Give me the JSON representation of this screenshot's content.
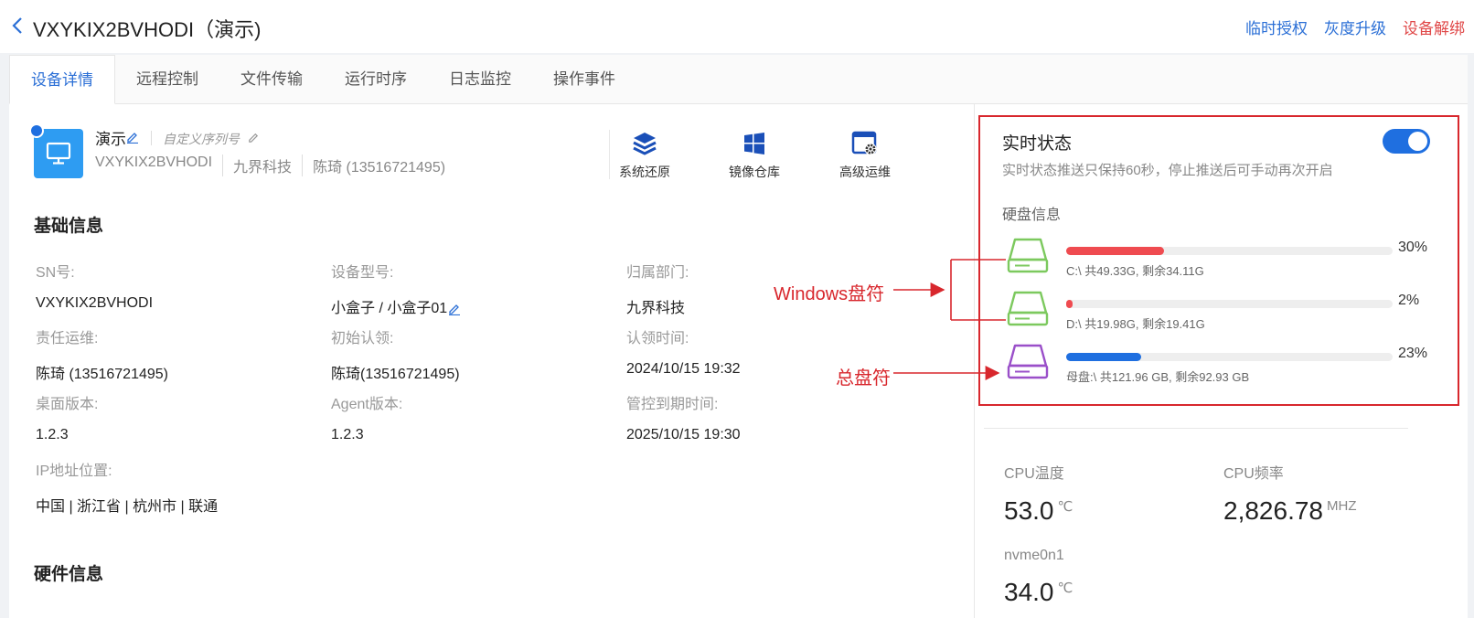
{
  "header": {
    "title": "VXYKIX2BVHODI（演示)",
    "actions": [
      "临时授权",
      "灰度升级",
      "设备解绑"
    ]
  },
  "tabs": [
    "设备详情",
    "远程控制",
    "文件传输",
    "运行时序",
    "日志监控",
    "操作事件"
  ],
  "device": {
    "name": "演示",
    "serial_placeholder": "自定义序列号",
    "meta": [
      "VXYKIX2BVHODI",
      "九界科技",
      "陈琦 (13516721495)"
    ]
  },
  "quick_actions": [
    {
      "label": "系统还原",
      "icon": "layers-icon"
    },
    {
      "label": "镜像仓库",
      "icon": "windows-icon"
    },
    {
      "label": "高级运维",
      "icon": "settings-window-icon"
    }
  ],
  "basic_info": {
    "title": "基础信息",
    "fields": [
      {
        "label": "SN号:",
        "value": "VXYKIX2BVHODI"
      },
      {
        "label": "设备型号:",
        "value": "小盒子  / 小盒子01"
      },
      {
        "label": "归属部门:",
        "value": "九界科技"
      },
      {
        "label": "责任运维:",
        "value": "陈琦 (13516721495)"
      },
      {
        "label": "初始认领:",
        "value": "陈琦(13516721495)"
      },
      {
        "label": "认领时间:",
        "value": "2024/10/15 19:32"
      },
      {
        "label": "桌面版本:",
        "value": "1.2.3"
      },
      {
        "label": "Agent版本:",
        "value": "1.2.3"
      },
      {
        "label": "管控到期时间:",
        "value": "2025/10/15 19:30"
      },
      {
        "label": "IP地址位置:",
        "value": "中国 | 浙江省 | 杭州市 | 联通"
      }
    ]
  },
  "hardware_info": {
    "title": "硬件信息"
  },
  "realtime": {
    "title": "实时状态",
    "desc": "实时状态推送只保持60秒，停止推送后可手动再次开启",
    "toggle_on": true,
    "disk_title": "硬盘信息",
    "disks": [
      {
        "text": "C:\\ 共49.33G, 剩余34.11G",
        "percent_label": "30%",
        "percent": 30,
        "color": "#ef4b50",
        "icon_color": "#7cc95e"
      },
      {
        "text": "D:\\ 共19.98G, 剩余19.41G",
        "percent_label": "2%",
        "percent": 2,
        "color": "#ef4b50",
        "icon_color": "#7cc95e"
      },
      {
        "text": "母盘:\\ 共121.96 GB, 剩余92.93 GB",
        "percent_label": "23%",
        "percent": 23,
        "color": "#1f6fe0",
        "icon_color": "#9a4fc9"
      }
    ]
  },
  "metrics": [
    {
      "label": "CPU温度",
      "value": "53.0",
      "unit": "℃"
    },
    {
      "label": "CPU频率",
      "value": "2,826.78",
      "unit": "MHZ"
    },
    {
      "label": "nvme0n1",
      "value": "34.0",
      "unit": "℃"
    }
  ],
  "annotations": {
    "windows": "Windows盘符",
    "total": "总盘符"
  },
  "colors": {
    "accent": "#2b6fd6",
    "danger": "#e04848",
    "annotation": "#d8272d"
  }
}
